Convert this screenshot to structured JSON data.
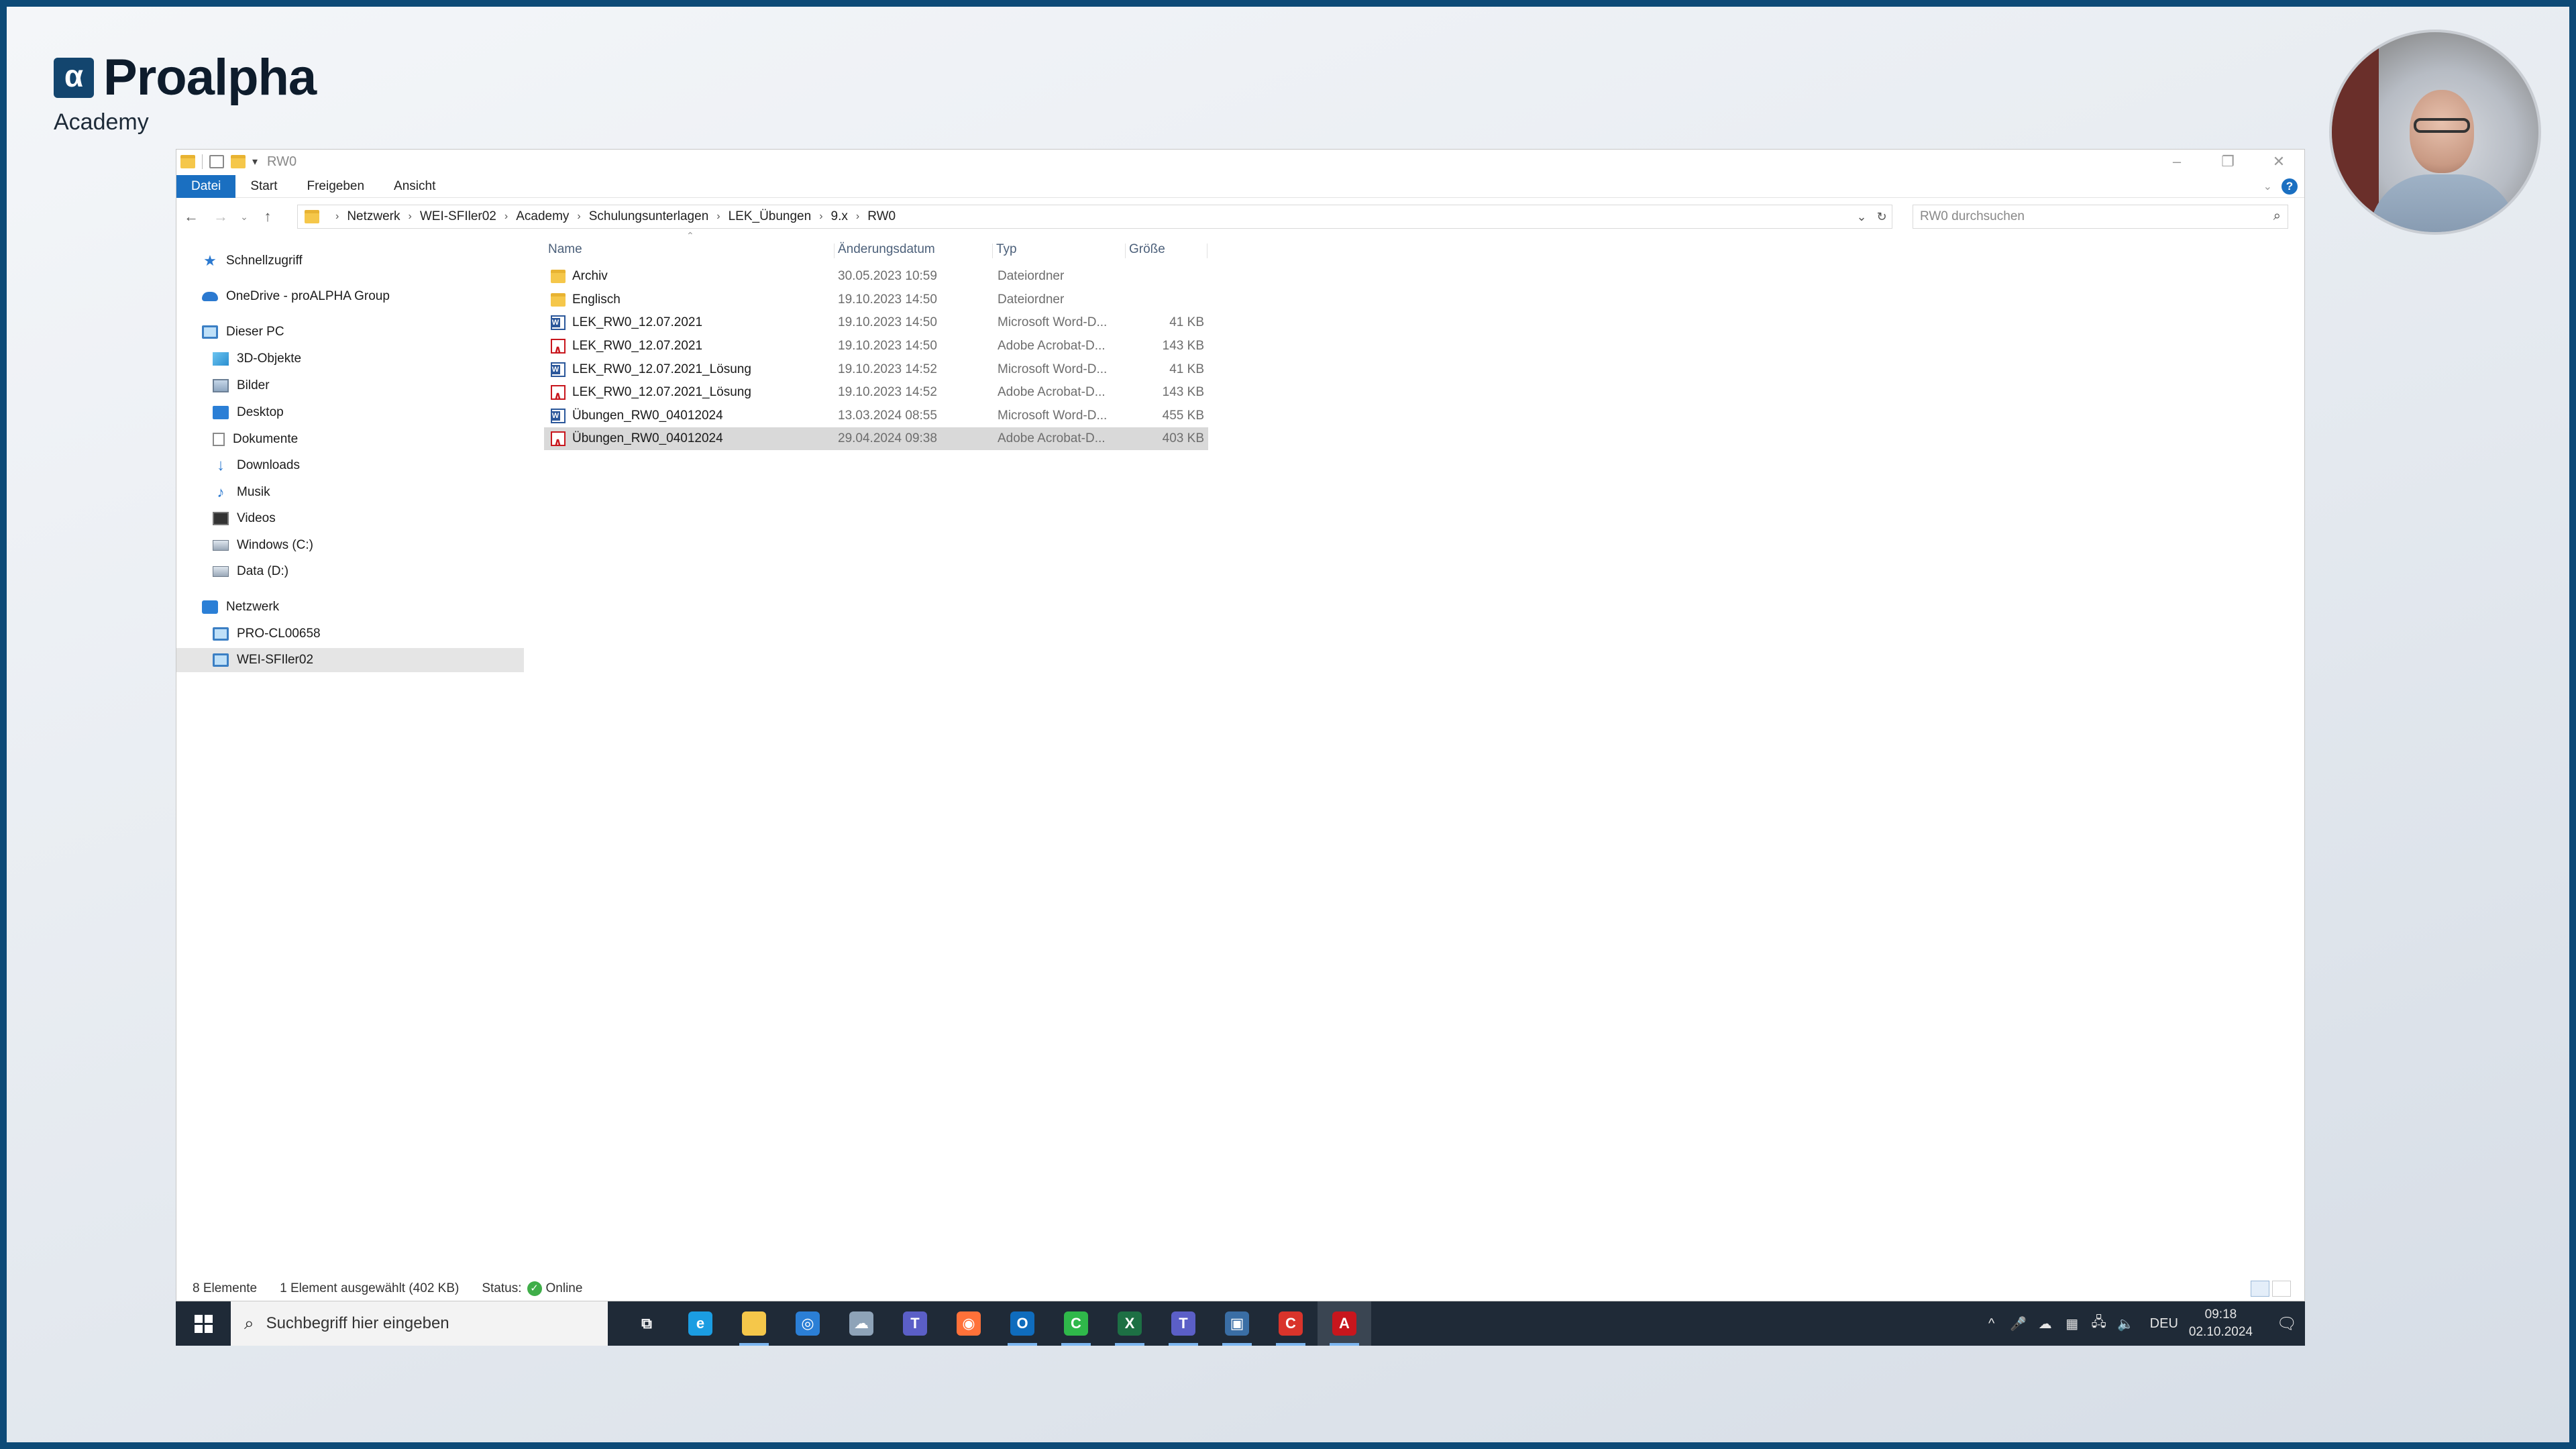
{
  "brand": {
    "name": "Proalpha",
    "sub": "Academy",
    "mark": "α"
  },
  "window": {
    "title": "RW0",
    "controls": {
      "minimize": "–",
      "restore": "❐",
      "close": "✕"
    }
  },
  "ribbon": {
    "tabs": [
      "Datei",
      "Start",
      "Freigeben",
      "Ansicht"
    ],
    "active": "Datei"
  },
  "address": {
    "crumbs": [
      "Netzwerk",
      "WEI-SFIler02",
      "Academy",
      "Schulungsunterlagen",
      "LEK_Übungen",
      "9.x",
      "RW0"
    ],
    "search_placeholder": "RW0 durchsuchen"
  },
  "nav": {
    "items": [
      {
        "label": "Schnellzugriff",
        "icon": "star-icon",
        "level": 0
      },
      {
        "label": "OneDrive - proALPHA Group",
        "icon": "cloud-icon",
        "level": 0
      },
      {
        "label": "Dieser PC",
        "icon": "pc-icon",
        "level": 0
      },
      {
        "label": "3D-Objekte",
        "icon": "cube-icon",
        "level": 1
      },
      {
        "label": "Bilder",
        "icon": "pictures-icon",
        "level": 1
      },
      {
        "label": "Desktop",
        "icon": "desktop-icon",
        "level": 1
      },
      {
        "label": "Dokumente",
        "icon": "documents-icon",
        "level": 1
      },
      {
        "label": "Downloads",
        "icon": "download-icon",
        "level": 1
      },
      {
        "label": "Musik",
        "icon": "music-icon",
        "level": 1
      },
      {
        "label": "Videos",
        "icon": "video-icon",
        "level": 1
      },
      {
        "label": "Windows (C:)",
        "icon": "drive-icon",
        "level": 1
      },
      {
        "label": "Data (D:)",
        "icon": "drive-icon",
        "level": 1
      },
      {
        "label": "Netzwerk",
        "icon": "network-icon",
        "level": 0
      },
      {
        "label": "PRO-CL00658",
        "icon": "computer-icon",
        "level": 1
      },
      {
        "label": "WEI-SFIler02",
        "icon": "computer-icon",
        "level": 1,
        "selected": true
      }
    ]
  },
  "columns": {
    "name": "Name",
    "date": "Änderungsdatum",
    "type": "Typ",
    "size": "Größe"
  },
  "files": [
    {
      "name": "Archiv",
      "date": "30.05.2023 10:59",
      "type": "Dateiordner",
      "size": "",
      "icon": "folder"
    },
    {
      "name": "Englisch",
      "date": "19.10.2023 14:50",
      "type": "Dateiordner",
      "size": "",
      "icon": "folder"
    },
    {
      "name": "LEK_RW0_12.07.2021",
      "date": "19.10.2023 14:50",
      "type": "Microsoft Word-D...",
      "size": "41 KB",
      "icon": "word"
    },
    {
      "name": "LEK_RW0_12.07.2021",
      "date": "19.10.2023 14:50",
      "type": "Adobe Acrobat-D...",
      "size": "143 KB",
      "icon": "pdf"
    },
    {
      "name": "LEK_RW0_12.07.2021_Lösung",
      "date": "19.10.2023 14:52",
      "type": "Microsoft Word-D...",
      "size": "41 KB",
      "icon": "word"
    },
    {
      "name": "LEK_RW0_12.07.2021_Lösung",
      "date": "19.10.2023 14:52",
      "type": "Adobe Acrobat-D...",
      "size": "143 KB",
      "icon": "pdf"
    },
    {
      "name": "Übungen_RW0_04012024",
      "date": "13.03.2024 08:55",
      "type": "Microsoft Word-D...",
      "size": "455 KB",
      "icon": "word"
    },
    {
      "name": "Übungen_RW0_04012024",
      "date": "29.04.2024 09:38",
      "type": "Adobe Acrobat-D...",
      "size": "403 KB",
      "icon": "pdf",
      "selected": true
    }
  ],
  "status": {
    "count": "8 Elemente",
    "selection": "1 Element ausgewählt (402 KB)",
    "status_label": "Status:",
    "status_value": "Online"
  },
  "taskbar": {
    "search_placeholder": "Suchbegriff hier eingeben",
    "apps": [
      {
        "icon": "task-view-icon",
        "color": "transparent",
        "glyph": "⧉"
      },
      {
        "icon": "edge-icon",
        "color": "#1b9de2",
        "glyph": "e",
        "running": false
      },
      {
        "icon": "file-explorer-icon",
        "color": "#f5c74a",
        "glyph": "",
        "running": true
      },
      {
        "icon": "browser-icon",
        "color": "#2b7fd6",
        "glyph": "◎"
      },
      {
        "icon": "cloud-app-icon",
        "color": "#8ea3b8",
        "glyph": "☁"
      },
      {
        "icon": "teams-icon",
        "color": "#5b5fc7",
        "glyph": "T"
      },
      {
        "icon": "firefox-icon",
        "color": "#ff7139",
        "glyph": "◉"
      },
      {
        "icon": "outlook-icon",
        "color": "#0f6cbd",
        "glyph": "O",
        "running": true
      },
      {
        "icon": "camtasia-icon",
        "color": "#2fb84a",
        "glyph": "C",
        "running": true
      },
      {
        "icon": "excel-icon",
        "color": "#1d7044",
        "glyph": "X",
        "running": true
      },
      {
        "icon": "teams-check-icon",
        "color": "#5b5fc7",
        "glyph": "T",
        "running": true
      },
      {
        "icon": "remote-desktop-icon",
        "color": "#3a6ea5",
        "glyph": "▣",
        "running": true
      },
      {
        "icon": "recorder-icon",
        "color": "#d9342b",
        "glyph": "C",
        "running": true
      },
      {
        "icon": "acrobat-icon",
        "color": "#c8161d",
        "glyph": "A",
        "running": true,
        "active": true
      }
    ],
    "tray_language": "DEU",
    "time": "09:18",
    "date": "02.10.2024"
  }
}
